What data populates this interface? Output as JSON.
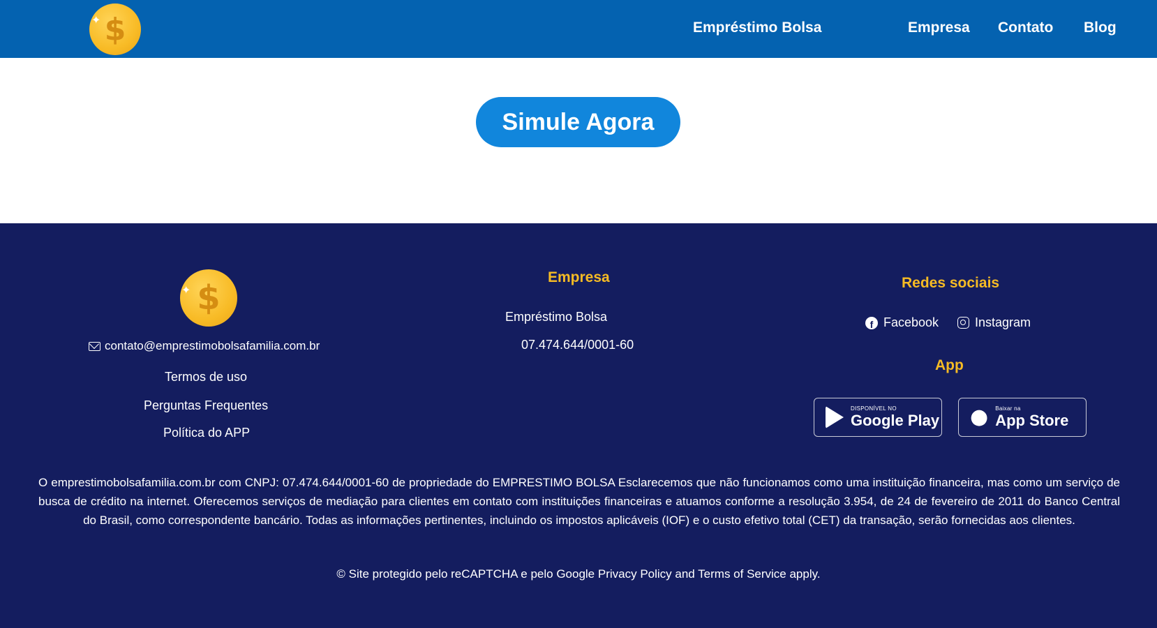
{
  "header": {
    "nav": {
      "emprestimo": "Empréstimo Bolsa",
      "empresa": "Empresa",
      "contato": "Contato",
      "blog": "Blog"
    },
    "logo_symbol": "$",
    "logo_icon": "dollar-coin-icon"
  },
  "hero": {
    "cta_label": "Simule Agora"
  },
  "footer": {
    "logo_symbol": "$",
    "email": "contato@emprestimobolsafamilia.com.br",
    "links": {
      "termos": "Termos de uso",
      "perguntas": "Perguntas Frequentes",
      "politica": "Política do APP"
    },
    "empresa": {
      "heading": "Empresa",
      "name": "Empréstimo Bolsa",
      "cnpj": "07.474.644/0001-60"
    },
    "redes": {
      "heading": "Redes sociais",
      "facebook": "Facebook",
      "instagram": "Instagram"
    },
    "app": {
      "heading": "App",
      "google_small": "DISPONÍVEL NO",
      "google_big": "Google Play",
      "apple_small": "Baixar na",
      "apple_big": "App Store"
    },
    "disclaimer": "O emprestimobolsafamilia.com.br com CNPJ: 07.474.644/0001-60 de propriedade do EMPRESTIMO BOLSA Esclarecemos que não funcionamos como uma instituição financeira, mas como um serviço de busca de crédito na internet. Oferecemos serviços de mediação para clientes em contato com instituições financeiras e atuamos conforme a resolução 3.954, de 24 de fevereiro de 2011 do Banco Central do Brasil, como correspondente bancário. Todas as informações pertinentes, incluindo os impostos aplicáveis (IOF) e o custo efetivo total (CET) da transação, serão fornecidas aos clientes.",
    "copyright": "© Site protegido pelo reCAPTCHA e pelo Google Privacy Policy and Terms of Service apply."
  },
  "colors": {
    "header_bg": "#0462b0",
    "footer_bg": "#141d5f",
    "accent_yellow": "#f6bb24",
    "cta_blue": "#1186dc"
  }
}
